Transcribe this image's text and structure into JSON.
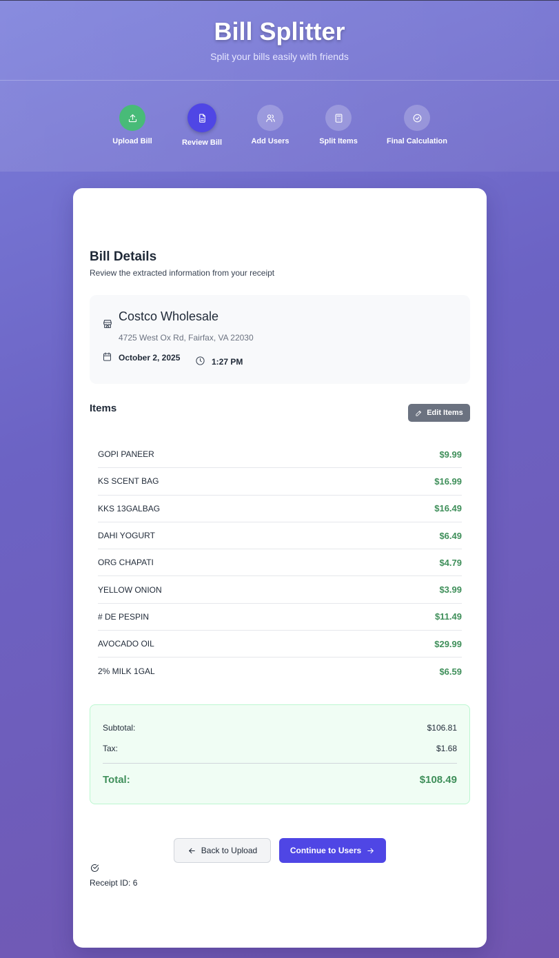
{
  "header": {
    "title": "Bill Splitter",
    "subtitle": "Split your bills easily with friends"
  },
  "steps": [
    {
      "label": "Upload Bill",
      "icon": "upload-icon",
      "state": "done"
    },
    {
      "label": "Review Bill",
      "icon": "document-icon",
      "state": "active"
    },
    {
      "label": "Add Users",
      "icon": "users-icon",
      "state": "pending"
    },
    {
      "label": "Split Items",
      "icon": "calculator-icon",
      "state": "pending"
    },
    {
      "label": "Final Calculation",
      "icon": "check-circle-icon",
      "state": "pending"
    }
  ],
  "bill": {
    "title": "Bill Details",
    "subtitle": "Review the extracted information from your receipt",
    "store_name": "Costco Wholesale",
    "store_address": "4725 West Ox Rd, Fairfax, VA 22030",
    "date": "October 2, 2025",
    "time": "1:27 PM"
  },
  "items_section": {
    "title": "Items",
    "edit_label": "Edit Items",
    "items": [
      {
        "name": "GOPI PANEER",
        "price": "$9.99"
      },
      {
        "name": "KS SCENT BAG",
        "price": "$16.99"
      },
      {
        "name": "KKS 13GALBAG",
        "price": "$16.49"
      },
      {
        "name": "DAHI YOGURT",
        "price": "$6.49"
      },
      {
        "name": "ORG CHAPATI",
        "price": "$4.79"
      },
      {
        "name": "YELLOW ONION",
        "price": "$3.99"
      },
      {
        "name": "# DE PESPIN",
        "price": "$11.49"
      },
      {
        "name": "AVOCADO OIL",
        "price": "$29.99"
      },
      {
        "name": "2% MILK 1GAL",
        "price": "$6.59"
      }
    ]
  },
  "totals": {
    "subtotal_label": "Subtotal:",
    "subtotal_value": "$106.81",
    "tax_label": "Tax:",
    "tax_value": "$1.68",
    "total_label": "Total:",
    "total_value": "$108.49"
  },
  "actions": {
    "back_label": "Back to Upload",
    "continue_label": "Continue to Users"
  },
  "footer": {
    "receipt_id": "Receipt ID: 6"
  },
  "colors": {
    "accent": "#4f46e5",
    "success": "#48bb78",
    "price_green": "#3f8f5a"
  }
}
